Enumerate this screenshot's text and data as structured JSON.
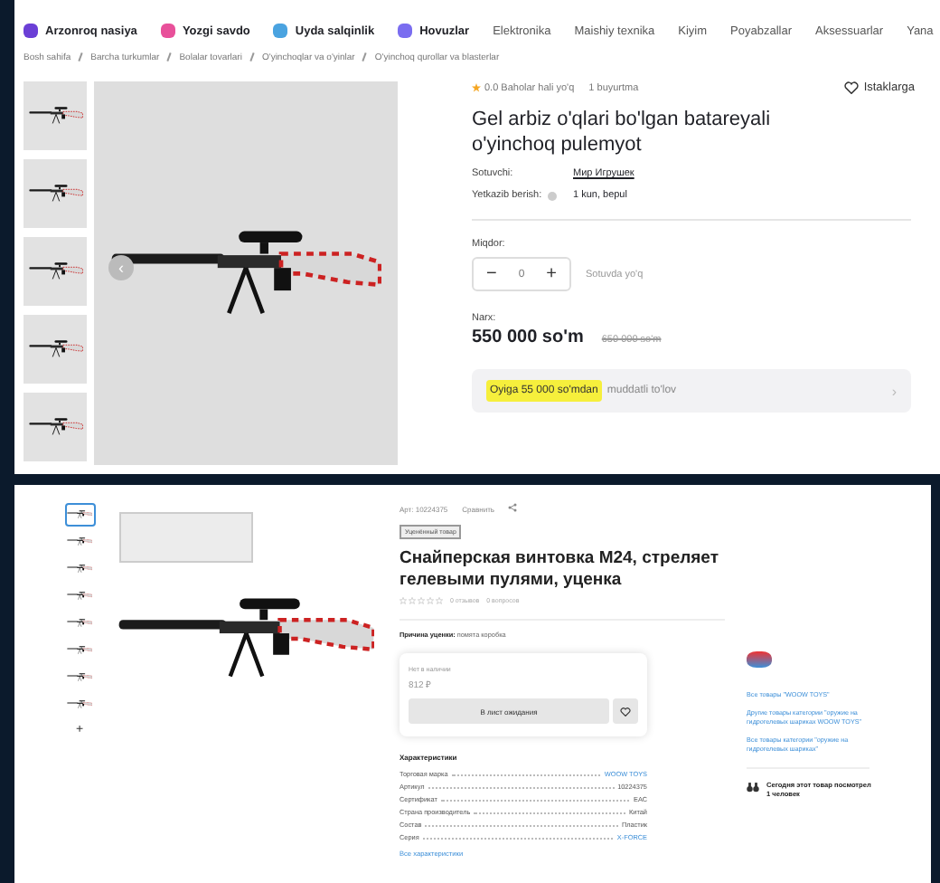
{
  "shop_uz": {
    "nav": [
      {
        "label": "Arzonroq nasiya",
        "kind": "promo",
        "color": "#6b3fd6"
      },
      {
        "label": "Yozgi savdo",
        "kind": "promo",
        "color": "#e8509a"
      },
      {
        "label": "Uyda salqinlik",
        "kind": "promo",
        "color": "#4aa3e0"
      },
      {
        "label": "Hovuzlar",
        "kind": "promo",
        "color": "#7a6df0"
      },
      {
        "label": "Elektronika",
        "kind": "plain"
      },
      {
        "label": "Maishiy texnika",
        "kind": "plain"
      },
      {
        "label": "Kiyim",
        "kind": "plain"
      },
      {
        "label": "Poyabzallar",
        "kind": "plain"
      },
      {
        "label": "Aksessuarlar",
        "kind": "plain"
      },
      {
        "label": "Yana",
        "kind": "more"
      }
    ],
    "breadcrumbs": [
      "Bosh sahifa",
      "Barcha turkumlar",
      "Bolalar tovarlari",
      "O'yinchoqlar va o'yinlar",
      "O'yinchoq qurollar va blasterlar"
    ],
    "thumbnails": [
      {
        "selected": false
      },
      {
        "selected": false
      },
      {
        "selected": false
      },
      {
        "selected": false
      },
      {
        "selected": false
      }
    ],
    "prev_arrow": "‹",
    "rating": "0.0 Baholar hali yo'q",
    "orders": "1 buyurtma",
    "wishlist": "Istaklarga",
    "title": "Gel arbiz o'qlari bo'lgan batareyali o'yinchoq pulemyot",
    "seller_label": "Sotuvchi:",
    "seller": "Мир Игрушек",
    "delivery_label": "Yetkazib berish:",
    "delivery": "1 kun, bepul",
    "quantity_label": "Miqdor:",
    "quantity": "0",
    "minus": "−",
    "plus": "+",
    "stock": "Sotuvda yo'q",
    "price_label": "Narx:",
    "price": "550 000 so'm",
    "old_price": "650 000 so'm",
    "installment_highlight": "Oyiga 55 000 so'mdan",
    "installment_text": "muddatli to'lov",
    "installment_arrow": "›"
  },
  "shop_ru": {
    "thumbnails": [
      {
        "selected": true
      },
      {
        "selected": false
      },
      {
        "selected": false
      },
      {
        "selected": false
      },
      {
        "selected": false
      },
      {
        "selected": false
      },
      {
        "selected": false
      },
      {
        "selected": false
      }
    ],
    "more_thumbs": "+",
    "sku": "Арт: 10224375",
    "compare": "Сравнить",
    "badge": "Уценённый товар",
    "title": "Снайперская винтовка M24, стреляет гелевыми пулями, уценка",
    "stars": 0,
    "reviews": "0 отзывов",
    "questions": "0 вопросов",
    "markdown_reason": "**Причина уценки:** помята коробка",
    "availability": "Нет в наличии",
    "price": "812 ₽",
    "waitlist_button": "В лист ожидания",
    "specs_title": "Характеристики",
    "specs": [
      {
        "name": "Торговая марка",
        "value": "WOOW TOYS",
        "kind": "link"
      },
      {
        "name": "Артикул",
        "value": "10224375",
        "kind": "text"
      },
      {
        "name": "Сертификат",
        "value": "ЕАС",
        "kind": "text"
      },
      {
        "name": "Страна производитель",
        "value": "Китай",
        "kind": "text"
      },
      {
        "name": "Состав",
        "value": "Пластик",
        "kind": "text"
      },
      {
        "name": "Серия",
        "value": "X-FORCE",
        "kind": "link"
      }
    ],
    "all_specs": "Все характеристики",
    "brand_links": [
      "Все товары \"WOOW TOYS\"",
      "Другие товары категории \"оружие на гидрогелевых шариках WOOW TOYS\"",
      "Все товары категории \"оружие на гидрогелевых шариках\""
    ],
    "views_note": "Сегодня этот товар посмотрел 1 человек"
  }
}
